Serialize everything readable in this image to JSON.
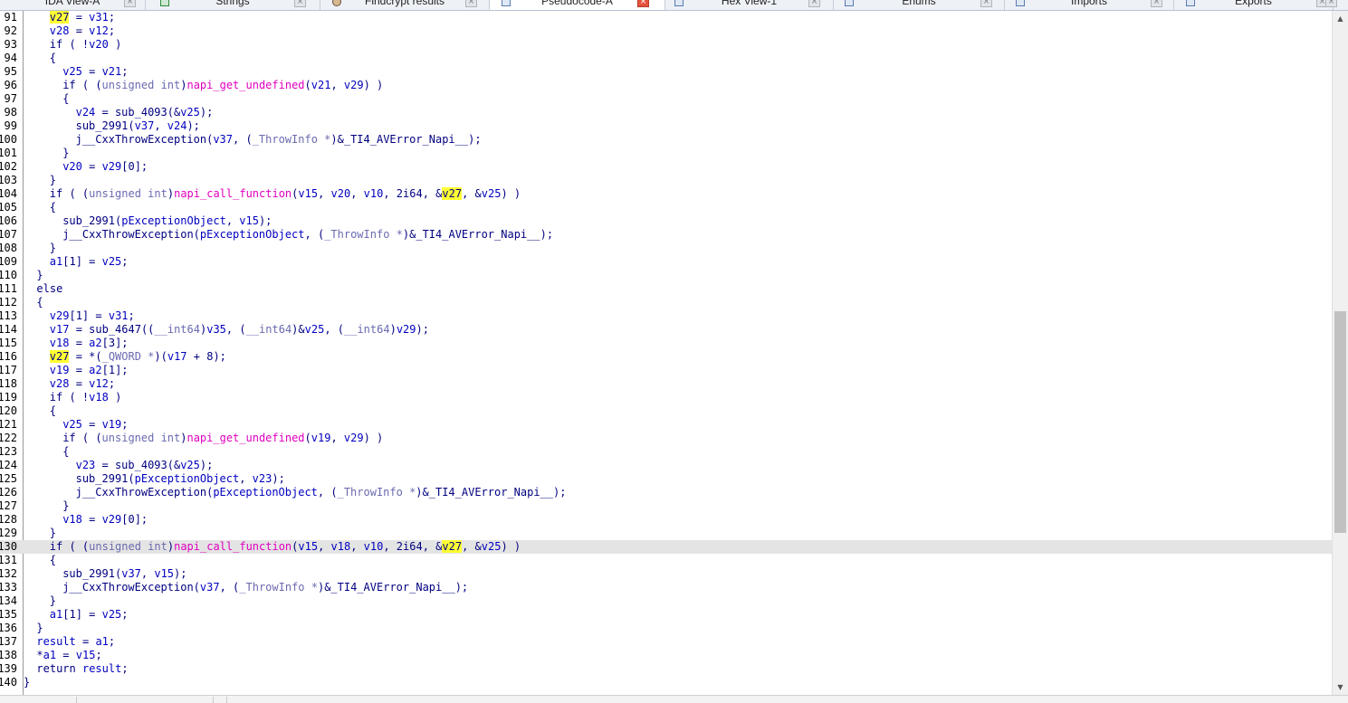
{
  "tabs": [
    {
      "label": "IDA View-A",
      "icon": "ida-view-icon",
      "active": false,
      "close": "×"
    },
    {
      "label": "Strings",
      "icon": "strings-icon",
      "active": false,
      "close": "×"
    },
    {
      "label": "Findcrypt results",
      "icon": "findcrypt-icon",
      "active": false,
      "close": "×"
    },
    {
      "label": "Pseudocode-A",
      "icon": "pseudocode-icon",
      "active": true,
      "close": "×"
    },
    {
      "label": "Hex View-1",
      "icon": "hex-view-icon",
      "active": false,
      "close": "×"
    },
    {
      "label": "Enums",
      "icon": "enums-icon",
      "active": false,
      "close": "×"
    },
    {
      "label": "Imports",
      "icon": "imports-icon",
      "active": false,
      "close": "×"
    },
    {
      "label": "Exports",
      "icon": "exports-icon",
      "active": false,
      "close": "×"
    }
  ],
  "extra_close": "×",
  "editor": {
    "current_line": 130,
    "highlight_token": "v27",
    "scroll_position": 0.66,
    "scroll_arrows": {
      "up": "▲",
      "down": "▼"
    },
    "lines": [
      {
        "n": "91",
        "indent": 4,
        "t": [
          [
            "v27",
            "v"
          ],
          [
            " = ",
            "n"
          ],
          [
            "v31",
            "v"
          ],
          [
            ";",
            "n"
          ]
        ]
      },
      {
        "n": "92",
        "indent": 4,
        "t": [
          [
            "v28",
            "v"
          ],
          [
            " = ",
            "n"
          ],
          [
            "v12",
            "v"
          ],
          [
            ";",
            "n"
          ]
        ]
      },
      {
        "n": "93",
        "indent": 4,
        "t": [
          [
            "if",
            "k"
          ],
          [
            " ( !",
            "n"
          ],
          [
            "v20",
            "v"
          ],
          [
            " )",
            "n"
          ]
        ]
      },
      {
        "n": "94",
        "indent": 4,
        "t": [
          [
            "{",
            "n"
          ]
        ]
      },
      {
        "n": "95",
        "indent": 6,
        "t": [
          [
            "v25",
            "v"
          ],
          [
            " = ",
            "n"
          ],
          [
            "v21",
            "v"
          ],
          [
            ";",
            "n"
          ]
        ]
      },
      {
        "n": "96",
        "indent": 6,
        "t": [
          [
            "if",
            "k"
          ],
          [
            " ( (",
            "n"
          ],
          [
            "unsigned int",
            "i"
          ],
          [
            ")",
            "n"
          ],
          [
            "napi_get_undefined",
            "f"
          ],
          [
            "(",
            "n"
          ],
          [
            "v21",
            "v"
          ],
          [
            ", ",
            "n"
          ],
          [
            "v29",
            "v"
          ],
          [
            ") )",
            "n"
          ]
        ]
      },
      {
        "n": "97",
        "indent": 6,
        "t": [
          [
            "{",
            "n"
          ]
        ]
      },
      {
        "n": "98",
        "indent": 8,
        "t": [
          [
            "v24",
            "v"
          ],
          [
            " = sub_4093(&",
            "n"
          ],
          [
            "v25",
            "v"
          ],
          [
            ");",
            "n"
          ]
        ]
      },
      {
        "n": "99",
        "indent": 8,
        "t": [
          [
            "sub_2991(",
            "n"
          ],
          [
            "v37",
            "v"
          ],
          [
            ", ",
            "n"
          ],
          [
            "v24",
            "v"
          ],
          [
            ");",
            "n"
          ]
        ]
      },
      {
        "n": "100",
        "indent": 8,
        "t": [
          [
            "j__CxxThrowException(",
            "n"
          ],
          [
            "v37",
            "v"
          ],
          [
            ", (",
            "n"
          ],
          [
            "_ThrowInfo *",
            "i"
          ],
          [
            ")&_TI4_AVError_Napi__);",
            "n"
          ]
        ]
      },
      {
        "n": "101",
        "indent": 6,
        "t": [
          [
            "}",
            "n"
          ]
        ]
      },
      {
        "n": "102",
        "indent": 6,
        "t": [
          [
            "v20",
            "v"
          ],
          [
            " = ",
            "n"
          ],
          [
            "v29",
            "v"
          ],
          [
            "[0];",
            "n"
          ]
        ]
      },
      {
        "n": "103",
        "indent": 4,
        "t": [
          [
            "}",
            "n"
          ]
        ]
      },
      {
        "n": "104",
        "indent": 4,
        "t": [
          [
            "if",
            "k"
          ],
          [
            " ( (",
            "n"
          ],
          [
            "unsigned int",
            "i"
          ],
          [
            ")",
            "n"
          ],
          [
            "napi_call_function",
            "f"
          ],
          [
            "(",
            "n"
          ],
          [
            "v15",
            "v"
          ],
          [
            ", ",
            "n"
          ],
          [
            "v20",
            "v"
          ],
          [
            ", ",
            "n"
          ],
          [
            "v10",
            "v"
          ],
          [
            ", 2i64, &",
            "n"
          ],
          [
            "v27",
            "v"
          ],
          [
            ", &",
            "n"
          ],
          [
            "v25",
            "v"
          ],
          [
            ") )",
            "n"
          ]
        ]
      },
      {
        "n": "105",
        "indent": 4,
        "t": [
          [
            "{",
            "n"
          ]
        ]
      },
      {
        "n": "106",
        "indent": 6,
        "t": [
          [
            "sub_2991(",
            "n"
          ],
          [
            "pExceptionObject",
            "v"
          ],
          [
            ", ",
            "n"
          ],
          [
            "v15",
            "v"
          ],
          [
            ");",
            "n"
          ]
        ]
      },
      {
        "n": "107",
        "indent": 6,
        "t": [
          [
            "j__CxxThrowException(",
            "n"
          ],
          [
            "pExceptionObject",
            "v"
          ],
          [
            ", (",
            "n"
          ],
          [
            "_ThrowInfo *",
            "i"
          ],
          [
            ")&_TI4_AVError_Napi__);",
            "n"
          ]
        ]
      },
      {
        "n": "108",
        "indent": 4,
        "t": [
          [
            "}",
            "n"
          ]
        ]
      },
      {
        "n": "109",
        "indent": 4,
        "t": [
          [
            "a1",
            "v"
          ],
          [
            "[1] = ",
            "n"
          ],
          [
            "v25",
            "v"
          ],
          [
            ";",
            "n"
          ]
        ]
      },
      {
        "n": "110",
        "indent": 2,
        "t": [
          [
            "}",
            "n"
          ]
        ]
      },
      {
        "n": "111",
        "indent": 2,
        "t": [
          [
            "else",
            "k"
          ]
        ]
      },
      {
        "n": "112",
        "indent": 2,
        "t": [
          [
            "{",
            "n"
          ]
        ]
      },
      {
        "n": "113",
        "indent": 4,
        "t": [
          [
            "v29",
            "v"
          ],
          [
            "[1] = ",
            "n"
          ],
          [
            "v31",
            "v"
          ],
          [
            ";",
            "n"
          ]
        ]
      },
      {
        "n": "114",
        "indent": 4,
        "t": [
          [
            "v17",
            "v"
          ],
          [
            " = sub_4647((",
            "n"
          ],
          [
            "__int64",
            "i"
          ],
          [
            ")",
            "n"
          ],
          [
            "v35",
            "v"
          ],
          [
            ", (",
            "n"
          ],
          [
            "__int64",
            "i"
          ],
          [
            ")&",
            "n"
          ],
          [
            "v25",
            "v"
          ],
          [
            ", (",
            "n"
          ],
          [
            "__int64",
            "i"
          ],
          [
            ")",
            "n"
          ],
          [
            "v29",
            "v"
          ],
          [
            ");",
            "n"
          ]
        ]
      },
      {
        "n": "115",
        "indent": 4,
        "t": [
          [
            "v18",
            "v"
          ],
          [
            " = ",
            "n"
          ],
          [
            "a2",
            "v"
          ],
          [
            "[3];",
            "n"
          ]
        ]
      },
      {
        "n": "116",
        "indent": 4,
        "t": [
          [
            "v27",
            "v"
          ],
          [
            " = *(",
            "n"
          ],
          [
            "_QWORD *",
            "i"
          ],
          [
            ")(",
            "n"
          ],
          [
            "v17",
            "v"
          ],
          [
            " + 8);",
            "n"
          ]
        ]
      },
      {
        "n": "117",
        "indent": 4,
        "t": [
          [
            "v19",
            "v"
          ],
          [
            " = ",
            "n"
          ],
          [
            "a2",
            "v"
          ],
          [
            "[1];",
            "n"
          ]
        ]
      },
      {
        "n": "118",
        "indent": 4,
        "t": [
          [
            "v28",
            "v"
          ],
          [
            " = ",
            "n"
          ],
          [
            "v12",
            "v"
          ],
          [
            ";",
            "n"
          ]
        ]
      },
      {
        "n": "119",
        "indent": 4,
        "t": [
          [
            "if",
            "k"
          ],
          [
            " ( !",
            "n"
          ],
          [
            "v18",
            "v"
          ],
          [
            " )",
            "n"
          ]
        ]
      },
      {
        "n": "120",
        "indent": 4,
        "t": [
          [
            "{",
            "n"
          ]
        ]
      },
      {
        "n": "121",
        "indent": 6,
        "t": [
          [
            "v25",
            "v"
          ],
          [
            " = ",
            "n"
          ],
          [
            "v19",
            "v"
          ],
          [
            ";",
            "n"
          ]
        ]
      },
      {
        "n": "122",
        "indent": 6,
        "t": [
          [
            "if",
            "k"
          ],
          [
            " ( (",
            "n"
          ],
          [
            "unsigned int",
            "i"
          ],
          [
            ")",
            "n"
          ],
          [
            "napi_get_undefined",
            "f"
          ],
          [
            "(",
            "n"
          ],
          [
            "v19",
            "v"
          ],
          [
            ", ",
            "n"
          ],
          [
            "v29",
            "v"
          ],
          [
            ") )",
            "n"
          ]
        ]
      },
      {
        "n": "123",
        "indent": 6,
        "t": [
          [
            "{",
            "n"
          ]
        ]
      },
      {
        "n": "124",
        "indent": 8,
        "t": [
          [
            "v23",
            "v"
          ],
          [
            " = sub_4093(&",
            "n"
          ],
          [
            "v25",
            "v"
          ],
          [
            ");",
            "n"
          ]
        ]
      },
      {
        "n": "125",
        "indent": 8,
        "t": [
          [
            "sub_2991(",
            "n"
          ],
          [
            "pExceptionObject",
            "v"
          ],
          [
            ", ",
            "n"
          ],
          [
            "v23",
            "v"
          ],
          [
            ");",
            "n"
          ]
        ]
      },
      {
        "n": "126",
        "indent": 8,
        "t": [
          [
            "j__CxxThrowException(",
            "n"
          ],
          [
            "pExceptionObject",
            "v"
          ],
          [
            ", (",
            "n"
          ],
          [
            "_ThrowInfo *",
            "i"
          ],
          [
            ")&_TI4_AVError_Napi__);",
            "n"
          ]
        ]
      },
      {
        "n": "127",
        "indent": 6,
        "t": [
          [
            "}",
            "n"
          ]
        ]
      },
      {
        "n": "128",
        "indent": 6,
        "t": [
          [
            "v18",
            "v"
          ],
          [
            " = ",
            "n"
          ],
          [
            "v29",
            "v"
          ],
          [
            "[0];",
            "n"
          ]
        ]
      },
      {
        "n": "129",
        "indent": 4,
        "t": [
          [
            "}",
            "n"
          ]
        ]
      },
      {
        "n": "130",
        "indent": 4,
        "t": [
          [
            "if",
            "k"
          ],
          [
            " ( (",
            "n"
          ],
          [
            "unsigned int",
            "i"
          ],
          [
            ")",
            "n"
          ],
          [
            "napi_call_function",
            "f"
          ],
          [
            "(",
            "n"
          ],
          [
            "v15",
            "v"
          ],
          [
            ", ",
            "n"
          ],
          [
            "v18",
            "v"
          ],
          [
            ", ",
            "n"
          ],
          [
            "v10",
            "v"
          ],
          [
            ", 2i64, &",
            "n"
          ],
          [
            "v27",
            "v"
          ],
          [
            ", &",
            "n"
          ],
          [
            "v25",
            "v"
          ],
          [
            ") )",
            "n"
          ]
        ]
      },
      {
        "n": "131",
        "indent": 4,
        "t": [
          [
            "{",
            "n"
          ]
        ]
      },
      {
        "n": "132",
        "indent": 6,
        "t": [
          [
            "sub_2991(",
            "n"
          ],
          [
            "v37",
            "v"
          ],
          [
            ", ",
            "n"
          ],
          [
            "v15",
            "v"
          ],
          [
            ");",
            "n"
          ]
        ]
      },
      {
        "n": "133",
        "indent": 6,
        "t": [
          [
            "j__CxxThrowException(",
            "n"
          ],
          [
            "v37",
            "v"
          ],
          [
            ", (",
            "n"
          ],
          [
            "_ThrowInfo *",
            "i"
          ],
          [
            ")&_TI4_AVError_Napi__);",
            "n"
          ]
        ]
      },
      {
        "n": "134",
        "indent": 4,
        "t": [
          [
            "}",
            "n"
          ]
        ]
      },
      {
        "n": "135",
        "indent": 4,
        "t": [
          [
            "a1",
            "v"
          ],
          [
            "[1] = ",
            "n"
          ],
          [
            "v25",
            "v"
          ],
          [
            ";",
            "n"
          ]
        ]
      },
      {
        "n": "136",
        "indent": 2,
        "t": [
          [
            "}",
            "n"
          ]
        ]
      },
      {
        "n": "137",
        "indent": 2,
        "t": [
          [
            "result",
            "v"
          ],
          [
            " = ",
            "n"
          ],
          [
            "a1",
            "v"
          ],
          [
            ";",
            "n"
          ]
        ]
      },
      {
        "n": "138",
        "indent": 2,
        "t": [
          [
            "*",
            "n"
          ],
          [
            "a1",
            "v"
          ],
          [
            " = ",
            "n"
          ],
          [
            "v15",
            "v"
          ],
          [
            ";",
            "n"
          ]
        ]
      },
      {
        "n": "139",
        "indent": 2,
        "t": [
          [
            "return",
            "k"
          ],
          [
            " ",
            "n"
          ],
          [
            "result",
            "v"
          ],
          [
            ";",
            "n"
          ]
        ]
      },
      {
        "n": "140",
        "indent": 0,
        "t": [
          [
            "}",
            "n"
          ]
        ]
      }
    ]
  }
}
